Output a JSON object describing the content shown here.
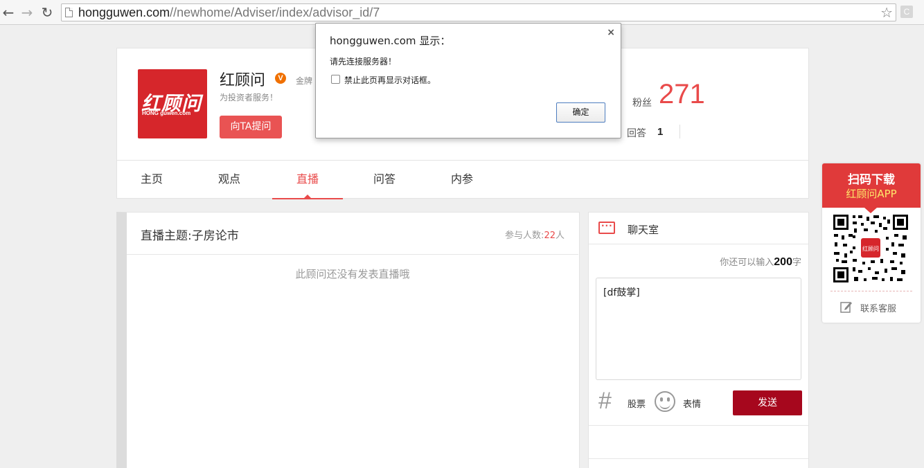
{
  "browser": {
    "url_host": "hongguwen.com",
    "url_path": "//newhome/Adviser/index/advisor_id/7",
    "extension_label": "C"
  },
  "profile": {
    "logo_cn": "红顾问",
    "logo_en": "HONG guwen.com",
    "name": "红顾问",
    "verified_badge": "V",
    "title_partial": "金牌",
    "slogan": "为投资者服务！",
    "ask_button": "向TA提问",
    "fans_label": "粉丝",
    "fans_count": "271",
    "answers_label": "回答",
    "answers_count": "1"
  },
  "tabs": [
    {
      "label": "主页"
    },
    {
      "label": "观点"
    },
    {
      "label": "直播"
    },
    {
      "label": "问答"
    },
    {
      "label": "内参"
    }
  ],
  "active_tab": "直播",
  "live": {
    "topic": "直播主题:子房论市",
    "participants_label": "参与人数:",
    "participants_count": "22",
    "participants_unit": "人",
    "empty_message": "此顾问还没有发表直播哦"
  },
  "chat": {
    "title": "聊天室",
    "remaining_prefix": "你还可以输入",
    "remaining_count": "200",
    "remaining_suffix": "字",
    "input_value": "[df鼓掌]",
    "stock_label": "股票",
    "emoji_label": "表情",
    "send_button": "发送"
  },
  "qr_widget": {
    "heading": "扫码下载",
    "subheading": "红顾问APP",
    "service_label": "联系客服"
  },
  "dialog": {
    "title": "hongguwen.com 显示：",
    "close_icon": "×",
    "message": "请先连接服务器！",
    "checkbox_label": "禁止此页再显示对话框。",
    "ok_button": "确定"
  },
  "colors": {
    "accent_red": "#e94a4a",
    "send_button": "#a6071d",
    "logo_red": "#d6262b",
    "qr_header": "#e03a3a",
    "qr_highlight": "#ffe76a"
  }
}
